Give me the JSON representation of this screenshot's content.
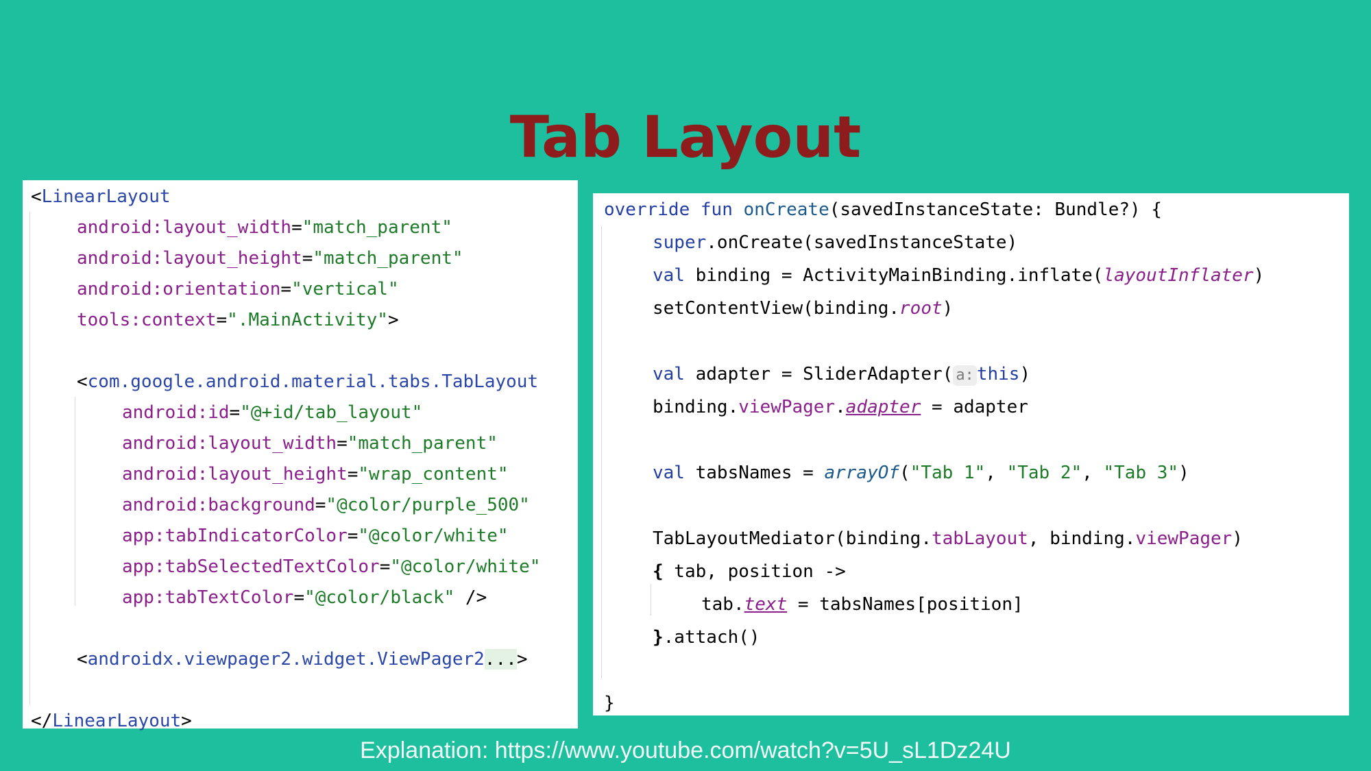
{
  "slide": {
    "title": "Tab Layout",
    "footer": "Explanation: https://www.youtube.com/watch?v=5U_sL1Dz24U"
  },
  "xml_code": {
    "l1_lt": "<",
    "l1_tag": "LinearLayout",
    "l2_attr": "android:layout_width",
    "l2_eq": "=",
    "l2_val": "\"match_parent\"",
    "l3_attr": "android:layout_height",
    "l3_eq": "=",
    "l3_val": "\"match_parent\"",
    "l4_attr": "android:orientation",
    "l4_eq": "=",
    "l4_val": "\"vertical\"",
    "l5_attr": "tools:context",
    "l5_eq": "=",
    "l5_val": "\".MainActivity\"",
    "l5_end": ">",
    "l7_lt": "<",
    "l7_tag": "com.google.android.material.tabs.TabLayout",
    "l8_attr": "android:id",
    "l8_eq": "=",
    "l8_val": "\"@+id/tab_layout\"",
    "l9_attr": "android:layout_width",
    "l9_eq": "=",
    "l9_val": "\"match_parent\"",
    "l10_attr": "android:layout_height",
    "l10_eq": "=",
    "l10_val": "\"wrap_content\"",
    "l11_attr": "android:background",
    "l11_eq": "=",
    "l11_val": "\"@color/purple_500\"",
    "l12_attr": "app:tabIndicatorColor",
    "l12_eq": "=",
    "l12_val": "\"@color/white\"",
    "l13_attr": "app:tabSelectedTextColor",
    "l13_eq": "=",
    "l13_val": "\"@color/white\"",
    "l14_attr": "app:tabTextColor",
    "l14_eq": "=",
    "l14_val": "\"@color/black\"",
    "l14_end": " />",
    "l16_lt": "<",
    "l16_tag": "androidx.viewpager2.widget.ViewPager2",
    "l16_fold": "...",
    "l16_end": ">",
    "l18_lt": "</",
    "l18_tag": "LinearLayout",
    "l18_end": ">"
  },
  "kotlin_code": {
    "l1_kw1": "override",
    "l1_kw2": "fun",
    "l1_name": "onCreate",
    "l1_rest": "(savedInstanceState: Bundle?) {",
    "l2_kw": "super",
    "l2_rest": ".onCreate(savedInstanceState)",
    "l3_kw": "val",
    "l3_rest": " binding = ActivityMainBinding.inflate(",
    "l3_prop": "layoutInflater",
    "l3_end": ")",
    "l4_a": "setContentView(binding.",
    "l4_prop": "root",
    "l4_end": ")",
    "l6_kw": "val",
    "l6_rest": " adapter = SliderAdapter(",
    "l6_hint": "a:",
    "l6_this": "this",
    "l6_end": ")",
    "l7_a": "binding.",
    "l7_p1": "viewPager",
    "l7_dot": ".",
    "l7_p2": "adapter",
    "l7_end": " = adapter",
    "l9_kw": "val",
    "l9_rest": " tabsNames = ",
    "l9_fn": "arrayOf",
    "l9_open": "(",
    "l9_s1": "\"Tab 1\"",
    "l9_c1": ", ",
    "l9_s2": "\"Tab 2\"",
    "l9_c2": ", ",
    "l9_s3": "\"Tab 3\"",
    "l9_end": ")",
    "l11_a": "TabLayoutMediator(binding.",
    "l11_p1": "tabLayout",
    "l11_b": ", binding.",
    "l11_p2": "viewPager",
    "l11_end": ")",
    "l12_brace": "{",
    "l12_rest": " tab, position ->",
    "l13_a": "tab.",
    "l13_prop": "text",
    "l13_end": " = tabsNames[position]",
    "l14_brace": "}",
    "l14_rest": ".attach()",
    "l16": "}"
  }
}
